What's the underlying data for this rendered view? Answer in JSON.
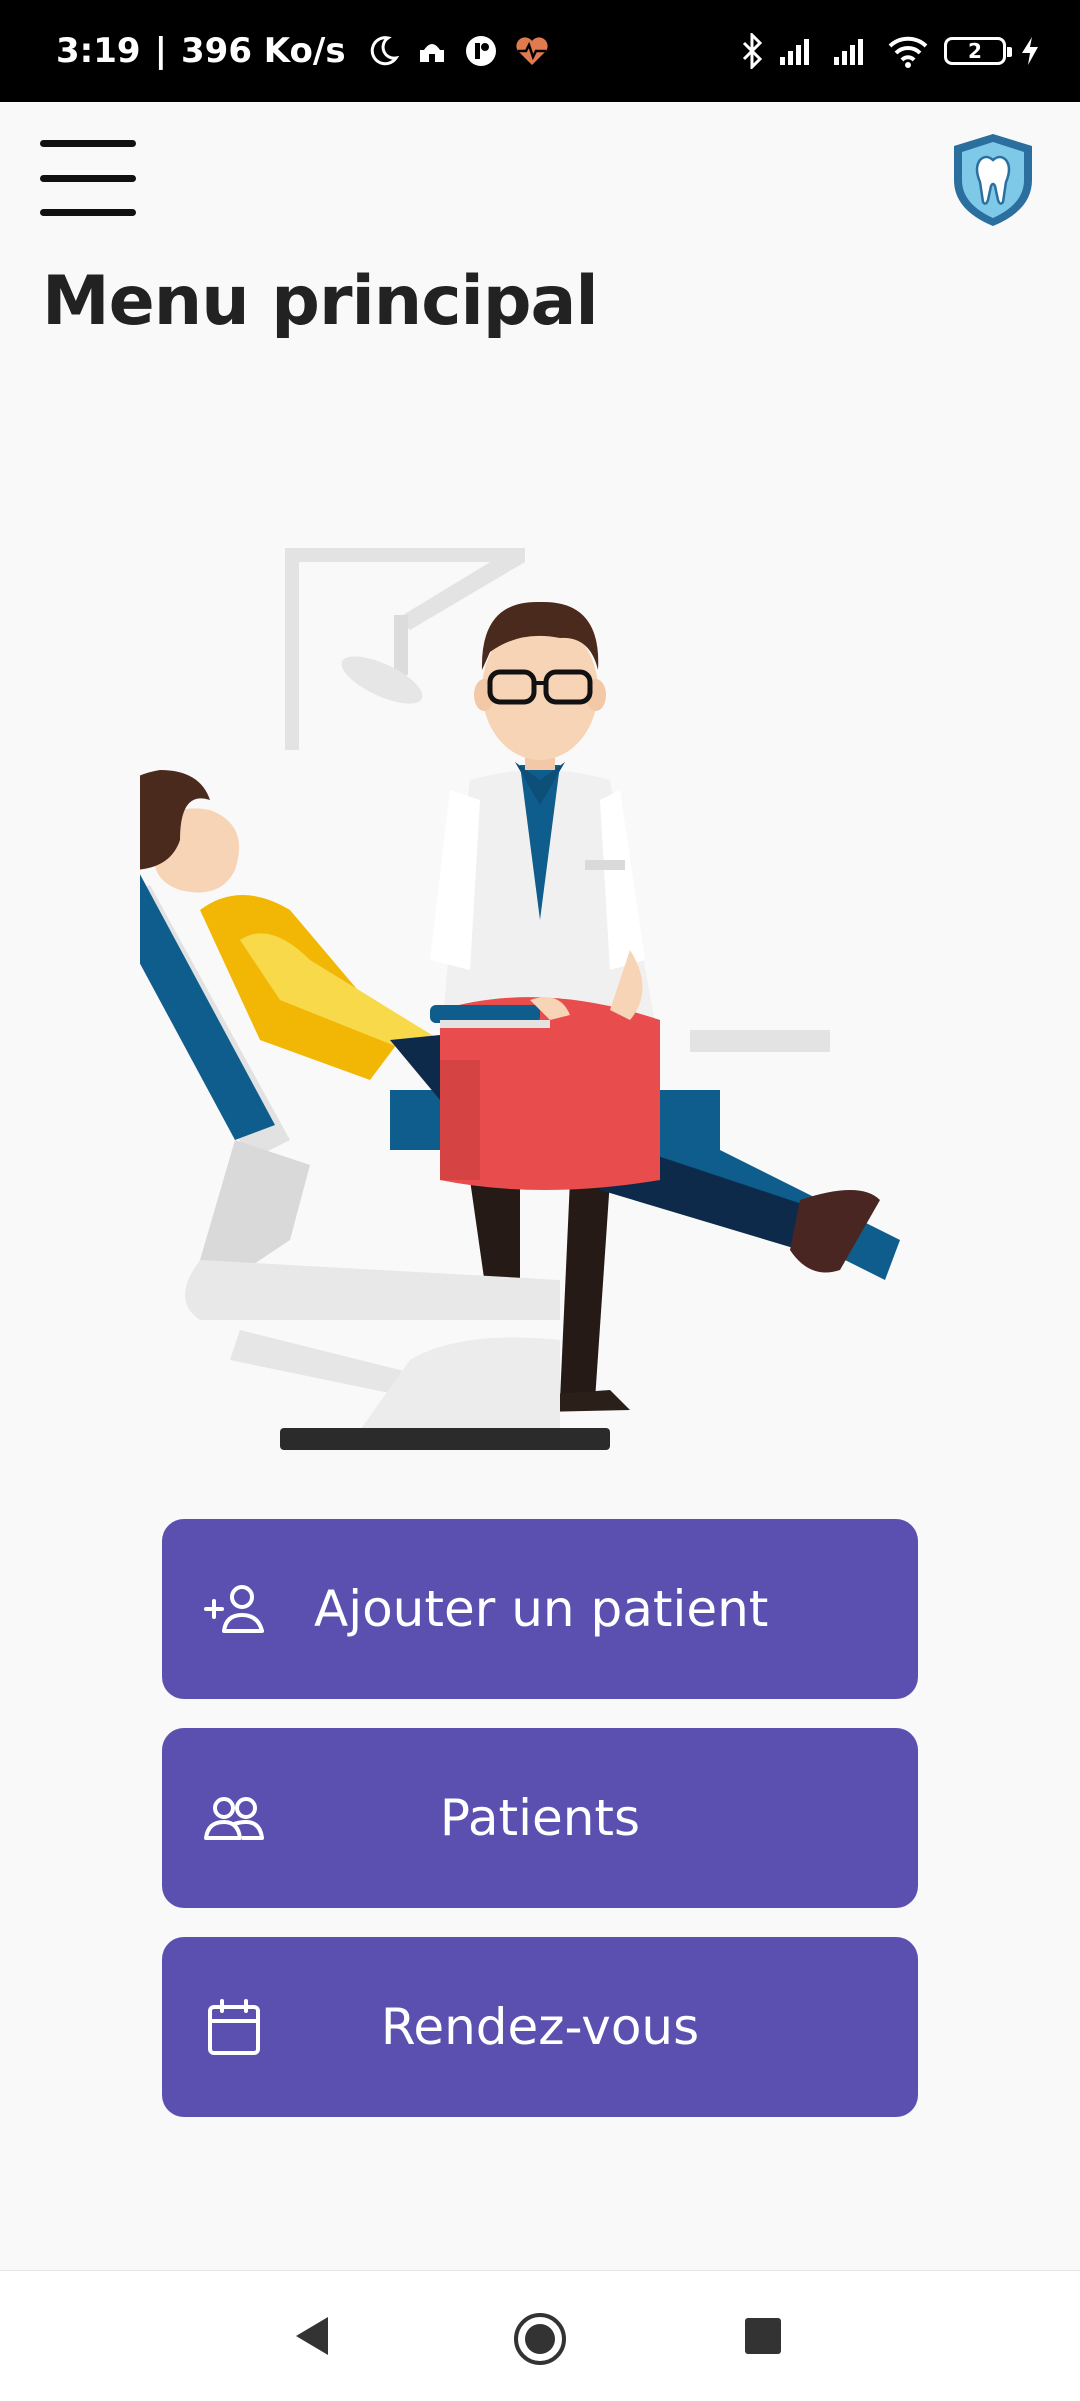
{
  "status_bar": {
    "time": "3:19",
    "separator": "|",
    "speed": "396 Ko/s",
    "battery": "2",
    "icons_left": [
      "moon-icon",
      "mosque-icon",
      "circle-app-icon",
      "heart-pulse-icon"
    ],
    "icons_right": [
      "bluetooth-icon",
      "signal-icon",
      "signal-icon",
      "wifi-icon",
      "battery-icon",
      "charging-icon"
    ]
  },
  "header": {
    "menu_icon": "hamburger-icon",
    "logo_icon": "tooth-shield-icon"
  },
  "page": {
    "title": "Menu principal"
  },
  "actions": {
    "add_patient": {
      "label": "Ajouter un patient",
      "icon": "add-person-icon"
    },
    "patients": {
      "label": "Patients",
      "icon": "people-icon"
    },
    "appointments": {
      "label": "Rendez-vous",
      "icon": "calendar-icon"
    }
  },
  "colors": {
    "accent": "#5b4fb0",
    "background": "#f9f9f9",
    "status_bar": "#000000",
    "logo_blue": "#2b6f9e"
  },
  "nav_bar": {
    "icons": [
      "back-icon",
      "home-icon",
      "recents-icon"
    ]
  }
}
